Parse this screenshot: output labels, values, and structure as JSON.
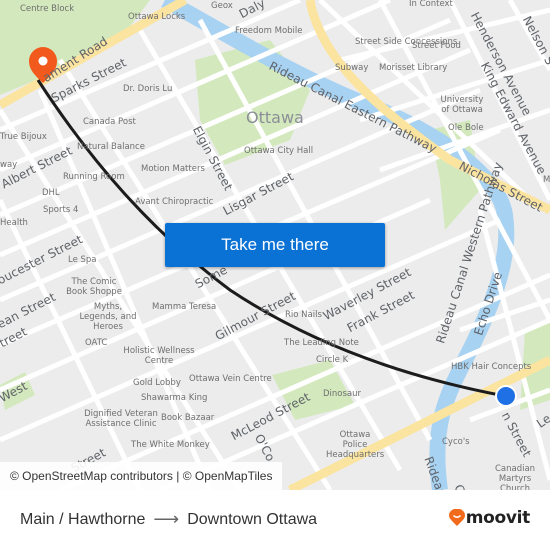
{
  "map": {
    "city_label": "Ottawa",
    "streets": [
      {
        "name": "Parliament Road",
        "text": "ament Road"
      },
      {
        "name": "Sparks Street",
        "text": "Sparks Street"
      },
      {
        "name": "Albert Street",
        "text": "Albert Street"
      },
      {
        "name": "Gloucester Street",
        "text": "oucester Street"
      },
      {
        "name": "Slater Street",
        "text": "ean Street"
      },
      {
        "name": "Laurier Street",
        "text": "treet"
      },
      {
        "name": "Elgin Street",
        "text": "Elgin Street"
      },
      {
        "name": "Lisgar Street",
        "text": "Lisgar Street"
      },
      {
        "name": "Somerset Street",
        "text": "Some"
      },
      {
        "name": "Gilmour Street",
        "text": "Gilmour Street"
      },
      {
        "name": "Waverley Street",
        "text": "Waverley Street"
      },
      {
        "name": "Frank Street",
        "text": "Frank Street"
      },
      {
        "name": "McLeod Street",
        "text": "McLeod Street"
      },
      {
        "name": "O'Connor Street",
        "text": "O'Co"
      },
      {
        "name": "Rideau Canal Eastern Pathway",
        "text": "Rideau Canal Eastern Pathway"
      },
      {
        "name": "Rideau Canal Western Pathway",
        "text": "Rideau Canal Western Pathway"
      },
      {
        "name": "Nicholas Street",
        "text": "Nicholas Street"
      },
      {
        "name": "Echo Drive",
        "text": "Echo Drive"
      },
      {
        "name": "Henderson Avenue",
        "text": "Henderson Avenue"
      },
      {
        "name": "King Edward Avenue",
        "text": "King Edward Avenue"
      },
      {
        "name": "Nelson Street",
        "text": "Nelson S"
      },
      {
        "name": "Daly Avenue",
        "text": "Daly"
      },
      {
        "name": "Main Street",
        "text": "n Street"
      },
      {
        "name": "Lees Avenue",
        "text": "Le"
      },
      {
        "name": "West",
        "text": "West"
      },
      {
        "name": "Cumberland Street",
        "text": "Street"
      },
      {
        "name": "Rideau Canal",
        "text": "Rideau C"
      },
      {
        "name": "Colonel By",
        "text": "Co"
      }
    ],
    "pois": [
      "Centre Block",
      "Ottawa Locks",
      "Geox",
      "Freedom Mobile",
      "In Context",
      "Street Side Concessions",
      "Street Food",
      "Subway",
      "Morisset Library",
      "University of Ottawa",
      "Ole Bole",
      "Dr. Doris Lu",
      "Canada Post",
      "True Bijoux",
      "Natural Balance",
      "Motion Matters",
      "Running Room",
      "Ottawa City Hall",
      "DHL",
      "Sports 4",
      "Avant Chiropractic",
      "Health",
      "Le Spa",
      "The Comic Book Shoppe",
      "Myths, Legends, and Heroes",
      "Mamma Teresa",
      "Rio Nails",
      "OATC",
      "Holistic Wellness Centre",
      "The Leading Note",
      "Circle K",
      "Gold Lobby",
      "Ottawa Vein Centre",
      "Shawarma King",
      "Dinosaur",
      "Dignified Veteran Assistance Clinic",
      "Book Bazaar",
      "Ottawa Police Headquarters",
      "The White Monkey",
      "HBK Hair Concepts",
      "Cyco's",
      "Canadian Martyrs Church",
      "way",
      "M"
    ],
    "origin_marker": {
      "label": "Main / Hawthorne",
      "color": "#1f6fe5"
    },
    "destination_marker": {
      "label": "Downtown Ottawa",
      "color": "#f25a1d"
    },
    "colors": {
      "background": "#ececec",
      "park": "#cfe7b8",
      "water": "#a8d2f2",
      "major_road": "#fbe3a0",
      "road": "#ffffff",
      "route_line": "#1c1c1c"
    }
  },
  "cta": {
    "label": "Take me there"
  },
  "attribution": "© OpenStreetMap contributors | © OpenMapTiles",
  "footer": {
    "origin": "Main / Hawthorne",
    "arrow": "⟶",
    "destination": "Downtown Ottawa",
    "brand": "moovit",
    "brand_color": "#f26b1d"
  }
}
